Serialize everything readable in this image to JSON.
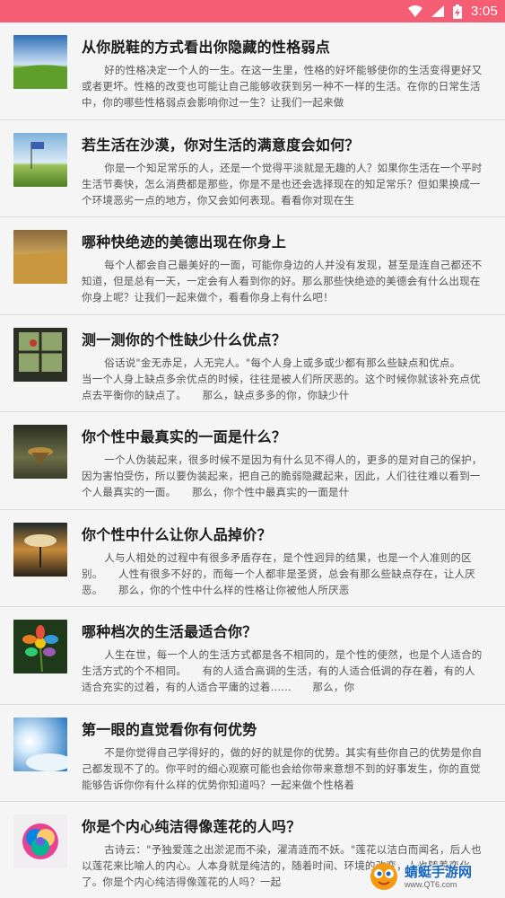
{
  "status_bar": {
    "time": "3:05",
    "icons": [
      "wifi-icon",
      "signal-icon",
      "battery-charging-icon"
    ],
    "color": "#f45d73"
  },
  "articles": [
    {
      "title": "从你脱鞋的方式看出你隐藏的性格弱点",
      "summary": "好的性格决定一个人的一生。在这一生里，性格的好坏能够使你的生活变得更好又或者更坏。性格的改变也可能让自己能够收获到另一种不一样的生活。在你的日常生活中，你的哪些性格弱点会影响你过一生？让我们一起来做",
      "thumb": "green-field-sky"
    },
    {
      "title": "若生活在沙漠，你对生活的满意度会如何？",
      "summary": "你是一个知足常乐的人，还是一个觉得平淡就是无趣的人？如果你生活在一个平时生活节奏快，怎么消费都是那些，你是不是也还会选择现在的知足常乐？但如果换成一个环境恶劣一点的地方，你又会如何表现。看看你对现在生",
      "thumb": "flag-on-hill"
    },
    {
      "title": "哪种快绝迹的美德出现在你身上",
      "summary": "每个人都会自己最美好的一面，可能你身边的人并没有发现，甚至是连自己都还不知道，但是总有一天，一定会有人看到你的好。那么那些快绝迹的美德会有什么出现在你身上呢？让我们一起来做个，看看你身上有什么吧！",
      "thumb": "wheat-field"
    },
    {
      "title": "测一测你的个性缺少什么优点？",
      "summary": "俗话说\"金无赤足，人无完人。\"每个人身上或多或少都有那么些缺点和优点。　　当一个人身上缺点多余优点的时候，往往是被人们所厌恶的。这个时候你就该补充点优点去平衡你的缺点了。　　那么，缺点多多的你，你缺少什",
      "thumb": "window-balloon"
    },
    {
      "title": "你个性中最真实的一面是什么？",
      "summary": "一个人伪装起来，很多时候不是因为有什么见不得人的，更多的是对自己的保护，因为害怕受伤，所以要伪装起来，把自己的脆弱隐藏起来，因此，人们往往难以看到一个人最真实的一面。　　那么，你个性中最真实的一面是什",
      "thumb": "floating-island"
    },
    {
      "title": "你个性中什么让你人品掉价？",
      "summary": "人与人相处的过程中有很多矛盾存在，是个性迥异的结果，也是一个人准则的区别。　　人性有很多不好的，而每一个人都非是圣贤，总会有那么些缺点存在，让人厌恶。　　那么，你的个性中什么样的性格让你被他人所厌恶",
      "thumb": "tree-cloud"
    },
    {
      "title": "哪种档次的生活最适合你？",
      "summary": "人生在世，每一个人的生活方式都是各不相同的，是个性的使然，也是个人适合的生活方式的个不相同。　　有的人适合高调的生活，有的人适合低调的存在着，有的人适合充实的过着，有的人适合平庸的过着……　　那么，你",
      "thumb": "rainbow-flower"
    },
    {
      "title": "第一眼的直觉看你有何优势",
      "summary": "不是你觉得自己学得好的，做的好的就是你的优势。其实有些你自己的优势是你自己都发现不了的。你平时的细心观察可能也会给你带来意想不到的好事发生，你的直觉能够告诉你你有什么样的优势你知道吗？一起来做个性格着",
      "thumb": "sun-clouds"
    },
    {
      "title": "你是个内心纯洁得像莲花的人吗？",
      "summary": "古诗云：\"予独爱莲之出淤泥而不染，濯清涟而不妖。\"莲花以洁白而闻名，后人也以莲花来比喻人的内心。人本身就是纯洁的，随着时间、环境的改变，人也随着变化了。你是个内心纯洁得像莲花的人吗？一起",
      "thumb": "rainbow-rose"
    }
  ],
  "watermark": {
    "title": "蜻蜓手游网",
    "url": "www.QT6.com"
  }
}
